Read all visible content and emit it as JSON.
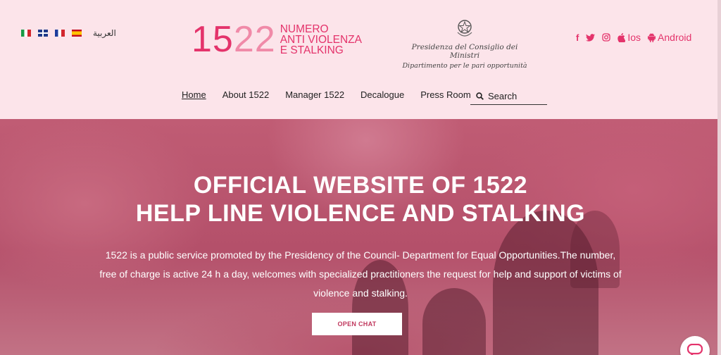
{
  "languages": [
    {
      "code": "it",
      "icon": "flag-italy-icon"
    },
    {
      "code": "en",
      "icon": "flag-uk-icon"
    },
    {
      "code": "fr",
      "icon": "flag-france-icon"
    },
    {
      "code": "es",
      "icon": "flag-spain-icon"
    }
  ],
  "arabic_label": "العربية",
  "logo": {
    "number_main": "15",
    "number_light": "22",
    "lines": [
      "NUMERO",
      "ANTI VIOLENZA",
      "E STALKING"
    ]
  },
  "government": {
    "line1": "Presidenza del Consiglio dei Ministri",
    "line2": "Dipartimento per le pari opportunità",
    "icon": "italian-emblem-icon"
  },
  "social": {
    "facebook": "f",
    "ios_label": "Ios",
    "android_label": "Android",
    "icons": [
      "facebook-icon",
      "twitter-icon",
      "instagram-icon",
      "apple-icon",
      "android-icon"
    ]
  },
  "nav": {
    "items": [
      "Home",
      "About 1522",
      "Manager 1522",
      "Decalogue",
      "Press Room"
    ],
    "search_placeholder": "Search"
  },
  "hero": {
    "title_line1": "OFFICIAL WEBSITE OF 1522",
    "title_line2": "HELP LINE VIOLENCE AND STALKING",
    "description": "1522 is a public service promoted by the Presidency of the Council- Department for Equal Opportunities.The number, free of charge is active 24 h a day, welcomes with specialized practitioners the request for help and support of victims of violence and stalking.",
    "cta_label": "OPEN CHAT"
  },
  "colors": {
    "brand_pink": "#e4336b",
    "header_bg": "#fce4ea",
    "hero_overlay": "#c05c74"
  }
}
